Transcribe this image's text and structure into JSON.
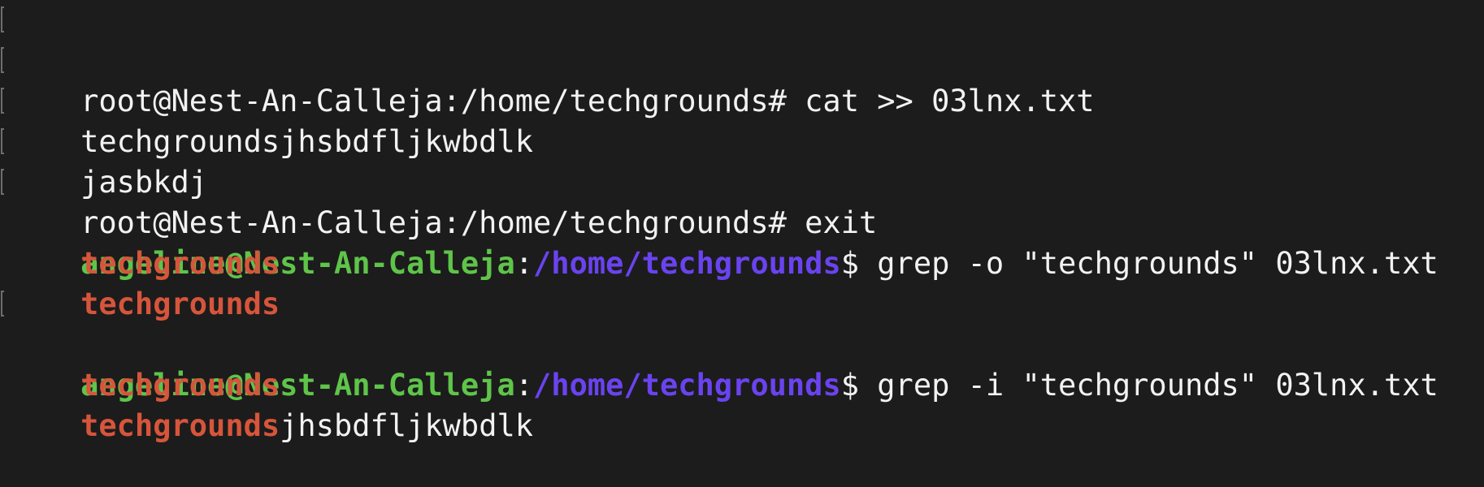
{
  "terminal": {
    "colors": {
      "background": "#1c1c1c",
      "text": "#f2f2f2",
      "user_host": "#5fc44a",
      "path": "#6a43f0",
      "match": "#d6553b"
    },
    "lines": [
      {
        "prompt": "root@Nest-An-Calleja:/home/techgrounds#",
        "command": " cat >> 03lnx.txt"
      },
      {
        "text": "techgroundsjhsbdfljkwbdlk"
      },
      {
        "text": "jasbkdj"
      },
      {
        "prompt": "root@Nest-An-Calleja:/home/techgrounds#",
        "command": " exit"
      },
      {
        "user_host": "angeline@Nest-An-Calleja",
        "sep": ":",
        "path": "/home/techgrounds",
        "dollar": "$",
        "command": " grep -o \"techgrounds\" 03lnx.txt"
      },
      {
        "match": "techgrounds"
      },
      {
        "match": "techgrounds"
      },
      {
        "user_host": "angeline@Nest-An-Calleja",
        "sep": ":",
        "path": "/home/techgrounds",
        "dollar": "$",
        "command": " grep -i \"techgrounds\" 03lnx.txt"
      },
      {
        "match": "techgrounds"
      },
      {
        "match": "techgrounds",
        "rest": "jhsbdfljkwbdlk"
      }
    ]
  }
}
